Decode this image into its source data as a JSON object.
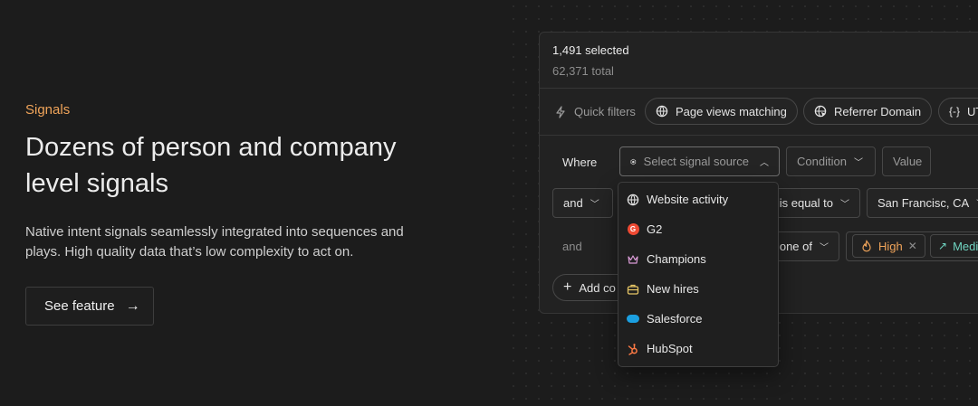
{
  "hero": {
    "eyebrow": "Signals",
    "headline": "Dozens of person and company level signals",
    "description": "Native intent signals seamlessly integrated into sequences and plays. High quality data that’s low complexity to act on.",
    "cta_label": "See feature",
    "cta_icon": "arrow-right-icon"
  },
  "panel": {
    "selected": "1,491 selected",
    "total": "62,371 total",
    "quick_filters_label": "Quick filters",
    "quick_filters": [
      {
        "label": "Page views matching",
        "icon": "globe-icon"
      },
      {
        "label": "Referrer Domain",
        "icon": "globe-cursor-icon"
      },
      {
        "label": "UT",
        "icon": "braces-icon"
      }
    ],
    "rows": [
      {
        "connector": "Where",
        "field": "Select signal source",
        "condition": "Condition",
        "value": "Value"
      },
      {
        "connector": "and",
        "condition": "is equal to",
        "value": "San Francisc, CA"
      },
      {
        "connector": "and",
        "condition": "one of",
        "tags": [
          {
            "label": "High",
            "icon": "flame-icon",
            "color": "#f0a45a"
          },
          {
            "label": "Medi",
            "icon": "trend-up-icon",
            "color": "#6fd3c0"
          }
        ]
      }
    ],
    "add_condition": "Add co"
  },
  "dropdown": {
    "items": [
      {
        "label": "Website activity",
        "icon": "globe-icon"
      },
      {
        "label": "G2",
        "icon": "g2-logo-icon"
      },
      {
        "label": "Champions",
        "icon": "crown-icon"
      },
      {
        "label": "New hires",
        "icon": "briefcase-icon"
      },
      {
        "label": "Salesforce",
        "icon": "salesforce-cloud-icon"
      },
      {
        "label": "HubSpot",
        "icon": "hubspot-icon"
      }
    ]
  },
  "colors": {
    "accent": "#f0a45a",
    "background": "#1c1c1c",
    "panel": "#222222"
  }
}
